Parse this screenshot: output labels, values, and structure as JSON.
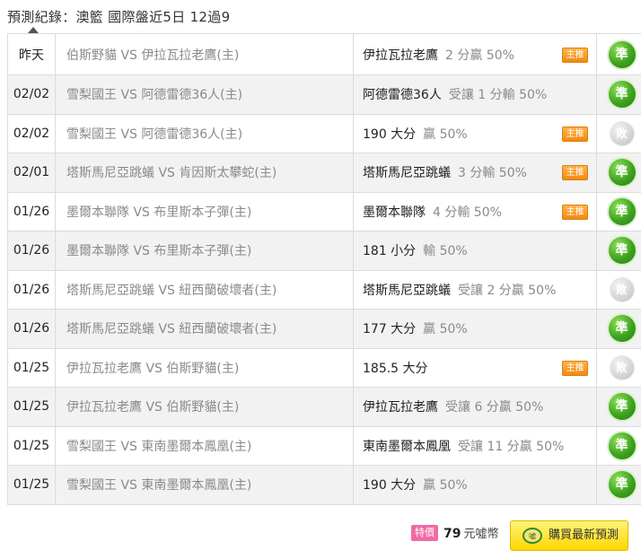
{
  "header": {
    "title": "預測紀錄：澳籃 國際盤近5日 12過9"
  },
  "badges": {
    "main": "主推",
    "hit": "準",
    "miss": "敗"
  },
  "rows": [
    {
      "date": "昨天",
      "match": "伯斯野貓 VS 伊拉瓦拉老鷹(主)",
      "pick": "伊拉瓦拉老鷹",
      "detail": "2 分贏 50%",
      "main": true,
      "result": "hit"
    },
    {
      "date": "02/02",
      "match": "雪梨國王 VS 阿德雷德36人(主)",
      "pick": "阿德雷德36人",
      "detail": "受讓 1 分輸 50%",
      "main": false,
      "result": "hit"
    },
    {
      "date": "02/02",
      "match": "雪梨國王 VS 阿德雷德36人(主)",
      "pick": "190 大分",
      "detail": "贏 50%",
      "main": true,
      "result": "miss"
    },
    {
      "date": "02/01",
      "match": "塔斯馬尼亞跳蟻 VS 肯因斯太攀蛇(主)",
      "pick": "塔斯馬尼亞跳蟻",
      "detail": "3 分輸 50%",
      "main": true,
      "result": "hit"
    },
    {
      "date": "01/26",
      "match": "墨爾本聯隊 VS 布里斯本子彈(主)",
      "pick": "墨爾本聯隊",
      "detail": "4 分輸 50%",
      "main": true,
      "result": "hit"
    },
    {
      "date": "01/26",
      "match": "墨爾本聯隊 VS 布里斯本子彈(主)",
      "pick": "181 小分",
      "detail": "輸 50%",
      "main": false,
      "result": "hit"
    },
    {
      "date": "01/26",
      "match": "塔斯馬尼亞跳蟻 VS 紐西蘭破壞者(主)",
      "pick": "塔斯馬尼亞跳蟻",
      "detail": "受讓 2 分贏 50%",
      "main": false,
      "result": "miss"
    },
    {
      "date": "01/26",
      "match": "塔斯馬尼亞跳蟻 VS 紐西蘭破壞者(主)",
      "pick": "177 大分",
      "detail": "贏 50%",
      "main": false,
      "result": "hit"
    },
    {
      "date": "01/25",
      "match": "伊拉瓦拉老鷹 VS 伯斯野貓(主)",
      "pick": "185.5 大分",
      "detail": "",
      "main": true,
      "result": "miss"
    },
    {
      "date": "01/25",
      "match": "伊拉瓦拉老鷹 VS 伯斯野貓(主)",
      "pick": "伊拉瓦拉老鷹",
      "detail": "受讓 6 分贏 50%",
      "main": false,
      "result": "hit"
    },
    {
      "date": "01/25",
      "match": "雪梨國王 VS 東南墨爾本鳳凰(主)",
      "pick": "東南墨爾本鳳凰",
      "detail": "受讓 11 分贏 50%",
      "main": false,
      "result": "hit"
    },
    {
      "date": "01/25",
      "match": "雪梨國王 VS 東南墨爾本鳳凰(主)",
      "pick": "190 大分",
      "detail": "贏 50%",
      "main": false,
      "result": "hit"
    }
  ],
  "footer": {
    "special_label": "特價",
    "price_value": "79",
    "price_unit": "元噓幣",
    "buy_label": "購買最新預測",
    "buy_icon_text": "噓"
  },
  "colors": {
    "hit_green": "#3da31f",
    "miss_gray": "#c8c8c8",
    "main_badge_orange": "#f5a030",
    "buy_yellow": "#ffe600",
    "special_pink": "#f06aa6"
  }
}
